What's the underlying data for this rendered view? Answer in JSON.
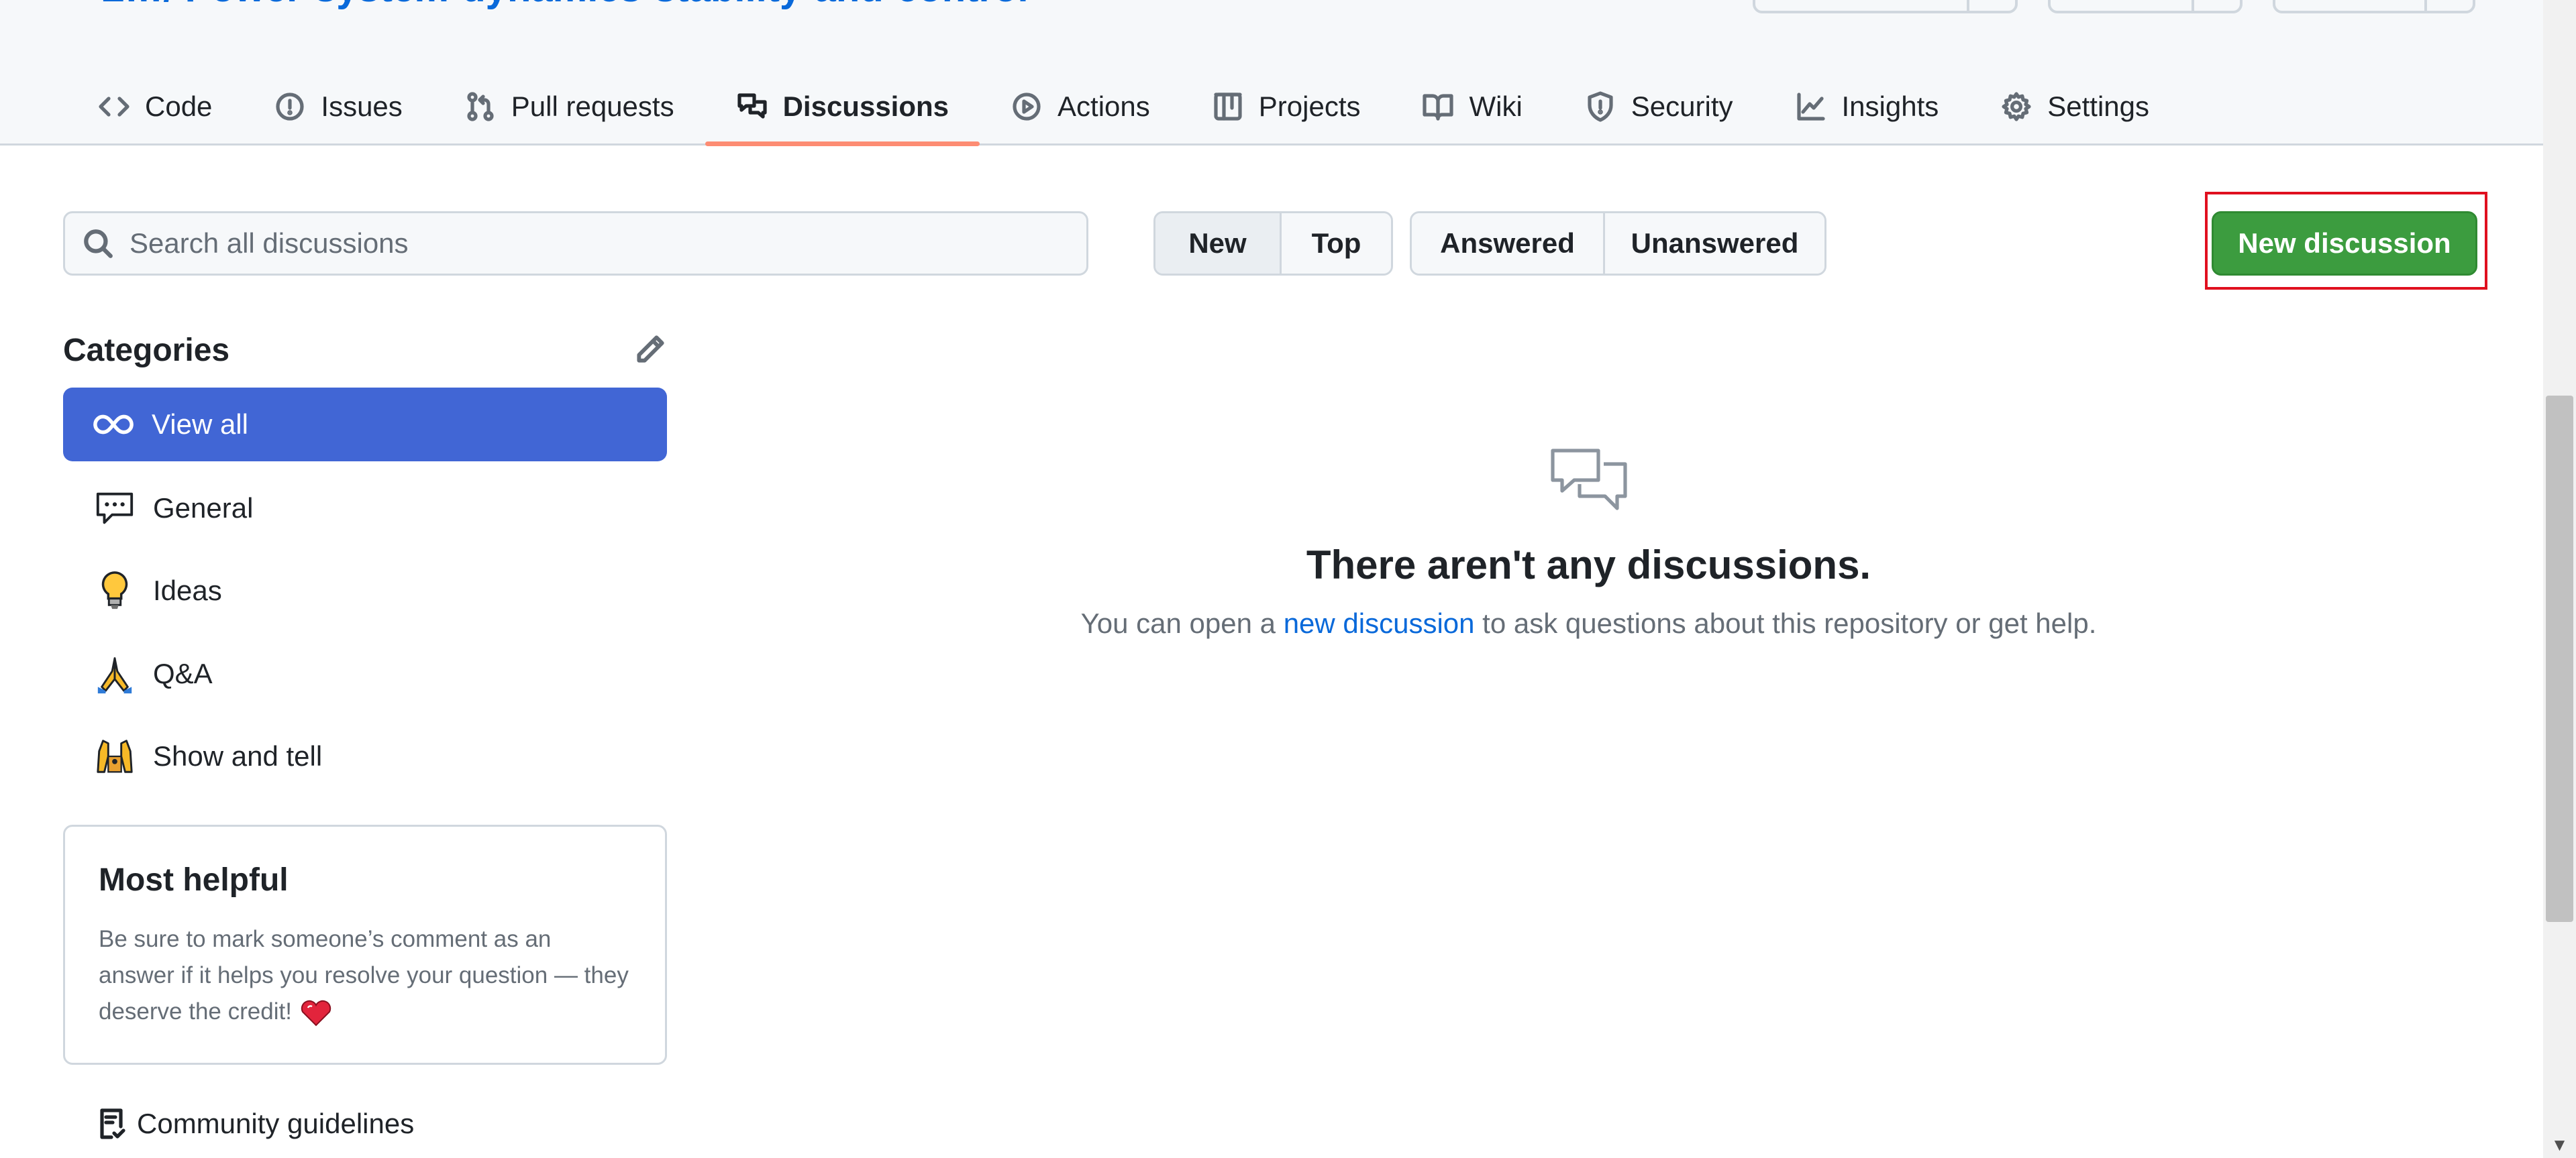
{
  "repo": {
    "title": "L…/ Power-system-dynamics-stability-and-control"
  },
  "tabs": [
    {
      "label": "Code",
      "icon": "code-icon"
    },
    {
      "label": "Issues",
      "icon": "issue-icon"
    },
    {
      "label": "Pull requests",
      "icon": "pull-request-icon"
    },
    {
      "label": "Discussions",
      "icon": "discussion-icon",
      "active": true
    },
    {
      "label": "Actions",
      "icon": "play-icon"
    },
    {
      "label": "Projects",
      "icon": "table-icon"
    },
    {
      "label": "Wiki",
      "icon": "book-icon"
    },
    {
      "label": "Security",
      "icon": "shield-icon"
    },
    {
      "label": "Insights",
      "icon": "graph-icon"
    },
    {
      "label": "Settings",
      "icon": "gear-icon"
    }
  ],
  "search": {
    "placeholder": "Search all discussions",
    "value": ""
  },
  "sort": {
    "new_label": "New",
    "top_label": "Top",
    "selected": "New"
  },
  "filter": {
    "answered_label": "Answered",
    "unanswered_label": "Unanswered"
  },
  "new_discussion": {
    "label": "New discussion",
    "color": "#3c9c3f"
  },
  "categories": {
    "title": "Categories",
    "items": [
      {
        "label": "View all",
        "icon": "infinity-icon",
        "active": true
      },
      {
        "label": "General",
        "icon": "speech-balloon-icon"
      },
      {
        "label": "Ideas",
        "icon": "light-bulb-icon"
      },
      {
        "label": "Q&A",
        "icon": "folded-hands-icon"
      },
      {
        "label": "Show and tell",
        "icon": "raised-hands-icon"
      }
    ]
  },
  "most_helpful": {
    "title": "Most helpful",
    "body": "Be sure to mark someone’s comment as an answer if it helps you resolve your question — they deserve the credit!"
  },
  "community_guidelines": {
    "label": "Community guidelines"
  },
  "empty_state": {
    "title": "There aren't any discussions.",
    "desc_before": "You can open a ",
    "desc_link": "new discussion",
    "desc_after": " to ask questions about this repository or get help."
  },
  "colors": {
    "accent_blue": "#4166d5",
    "link": "#0969da",
    "tab_underline": "#fd8c73",
    "highlight": "#e0101f"
  }
}
